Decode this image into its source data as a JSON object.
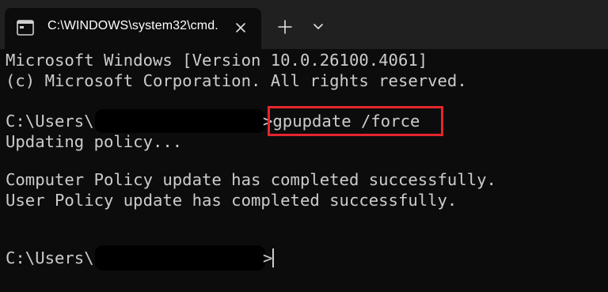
{
  "window": {
    "tab_title": "C:\\WINDOWS\\system32\\cmd.",
    "icons": {
      "tab": "terminal-icon",
      "close": "close-icon",
      "new_tab": "plus-icon",
      "dropdown": "chevron-down-icon"
    }
  },
  "terminal": {
    "lines": [
      "Microsoft Windows [Version 10.0.26100.4061]",
      "(c) Microsoft Corporation. All rights reserved.",
      "C:\\Users\\",
      ">gpupdate /force",
      "Updating policy...",
      "Computer Policy update has completed successfully.",
      "User Policy update has completed successfully.",
      "C:\\Users\\",
      ">"
    ],
    "highlighted_command": "gpupdate /force",
    "colors": {
      "background": "#0c0c0c",
      "text": "#cccccc",
      "highlight_border": "#e3262c"
    }
  }
}
